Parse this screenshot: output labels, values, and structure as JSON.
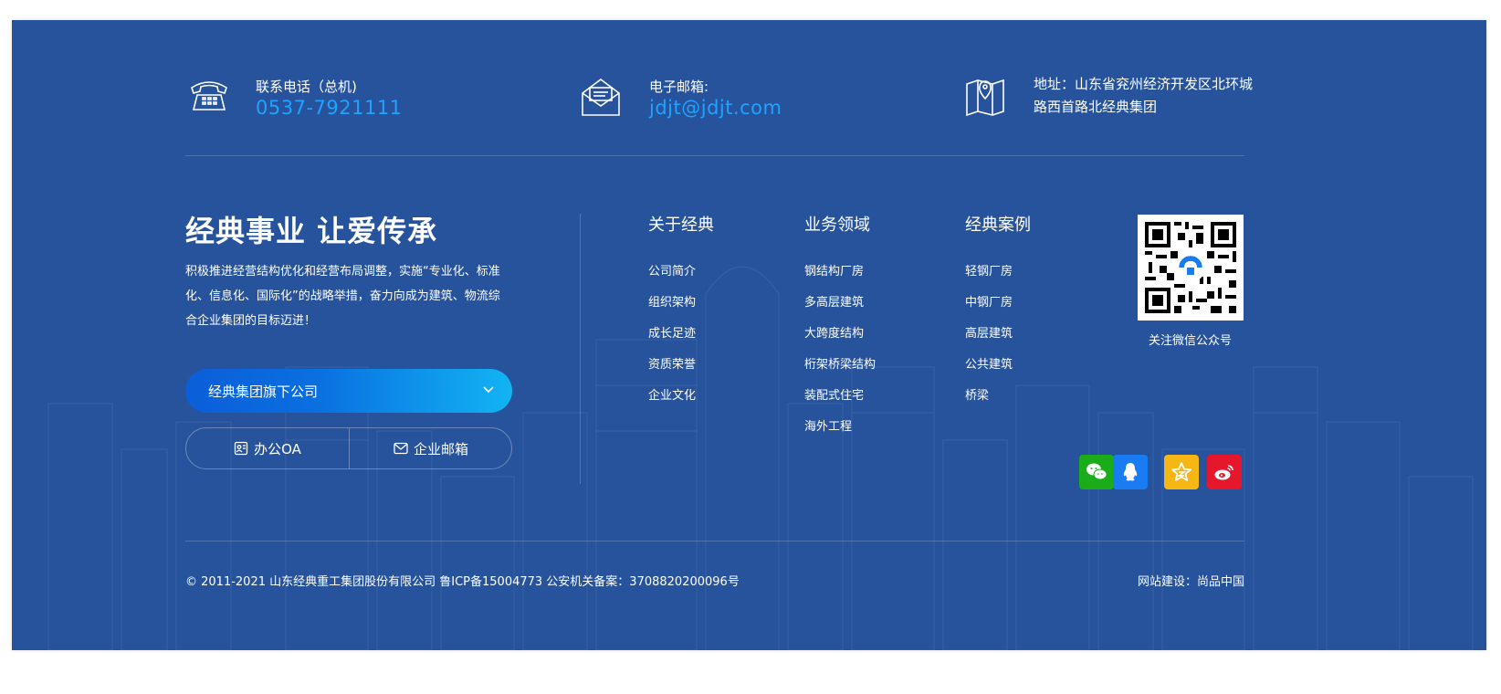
{
  "contact": {
    "phone_label": "联系电话（总机)",
    "phone_value": "0537-7921111",
    "email_label": "电子邮箱:",
    "email_value": "jdjt@jdjt.com",
    "address_text": "地址：山东省兖州经济开发区北环城路西首路北经典集团"
  },
  "intro": {
    "slogan": "经典事业 让爱传承",
    "description": "积极推进经营结构优化和经营布局调整，实施“专业化、标准化、信息化、国际化”的战略举措，奋力向成为建筑、物流综合企业集团的目标迈进！"
  },
  "subsidiary_select": {
    "label": "经典集团旗下公司"
  },
  "quick_links": {
    "oa_label": "办公OA",
    "mail_label": "企业邮箱"
  },
  "columns": [
    {
      "title": "关于经典",
      "items": [
        "公司简介",
        "组织架构",
        "成长足迹",
        "资质荣誉",
        "企业文化"
      ]
    },
    {
      "title": "业务领域",
      "items": [
        "钢结构厂房",
        "多高层建筑",
        "大跨度结构",
        "桁架桥梁结构",
        "装配式住宅",
        "海外工程"
      ]
    },
    {
      "title": "经典案例",
      "items": [
        "轻钢厂房",
        "中钢厂房",
        "高层建筑",
        "公共建筑",
        "桥梁"
      ]
    }
  ],
  "qr": {
    "caption": "关注微信公众号"
  },
  "social": [
    {
      "name": "wechat",
      "color": "#1aad19"
    },
    {
      "name": "qq",
      "color": "#1a7cf2"
    },
    {
      "name": "favorite",
      "color": "#f6b614"
    },
    {
      "name": "weibo",
      "color": "#e6162d"
    }
  ],
  "bottom": {
    "copyright": "© 2011-2021 山东经典重工集团股份有限公司 鲁ICP备15004773 公安机关备案：3708820200096号",
    "credit": "网站建设：尚品中国"
  },
  "colors": {
    "background": "#27539c",
    "accent": "#1fa3ff"
  }
}
